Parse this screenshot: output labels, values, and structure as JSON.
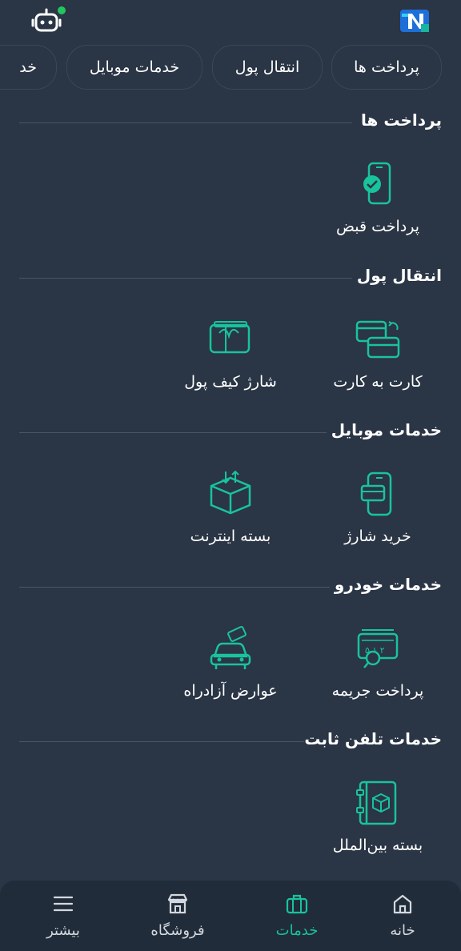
{
  "tabs": [
    {
      "label": "پرداخت ها"
    },
    {
      "label": "انتقال پول"
    },
    {
      "label": "خدمات موبایل"
    },
    {
      "label": "خد"
    }
  ],
  "sections": [
    {
      "title": "پرداخت ها",
      "items": [
        {
          "label": "پرداخت قبض",
          "icon": "bill-payment-icon"
        }
      ]
    },
    {
      "title": "انتقال پول",
      "items": [
        {
          "label": "کارت به کارت",
          "icon": "card-to-card-icon"
        },
        {
          "label": "شارژ کیف پول",
          "icon": "wallet-charge-icon"
        }
      ]
    },
    {
      "title": "خدمات موبایل",
      "items": [
        {
          "label": "خرید شارژ",
          "icon": "mobile-charge-icon"
        },
        {
          "label": "بسته اینترنت",
          "icon": "internet-package-icon"
        }
      ]
    },
    {
      "title": "خدمات خودرو",
      "items": [
        {
          "label": "پرداخت جریمه",
          "icon": "traffic-fine-icon"
        },
        {
          "label": "عوارض آزادراه",
          "icon": "freeway-toll-icon"
        }
      ]
    },
    {
      "title": "خدمات تلفن ثابت",
      "items": [
        {
          "label": "بسته بین‌الملل",
          "icon": "international-package-icon"
        }
      ]
    }
  ],
  "bottom_nav": [
    {
      "label": "خانه",
      "icon": "home-icon"
    },
    {
      "label": "خدمات",
      "icon": "briefcase-icon",
      "active": true
    },
    {
      "label": "فروشگاه",
      "icon": "store-icon"
    },
    {
      "label": "بیشتر",
      "icon": "menu-icon"
    }
  ],
  "colors": {
    "background": "#2a3545",
    "accent": "#19c39b",
    "nav_background": "#212c3b",
    "status_dot": "#22c55e"
  }
}
